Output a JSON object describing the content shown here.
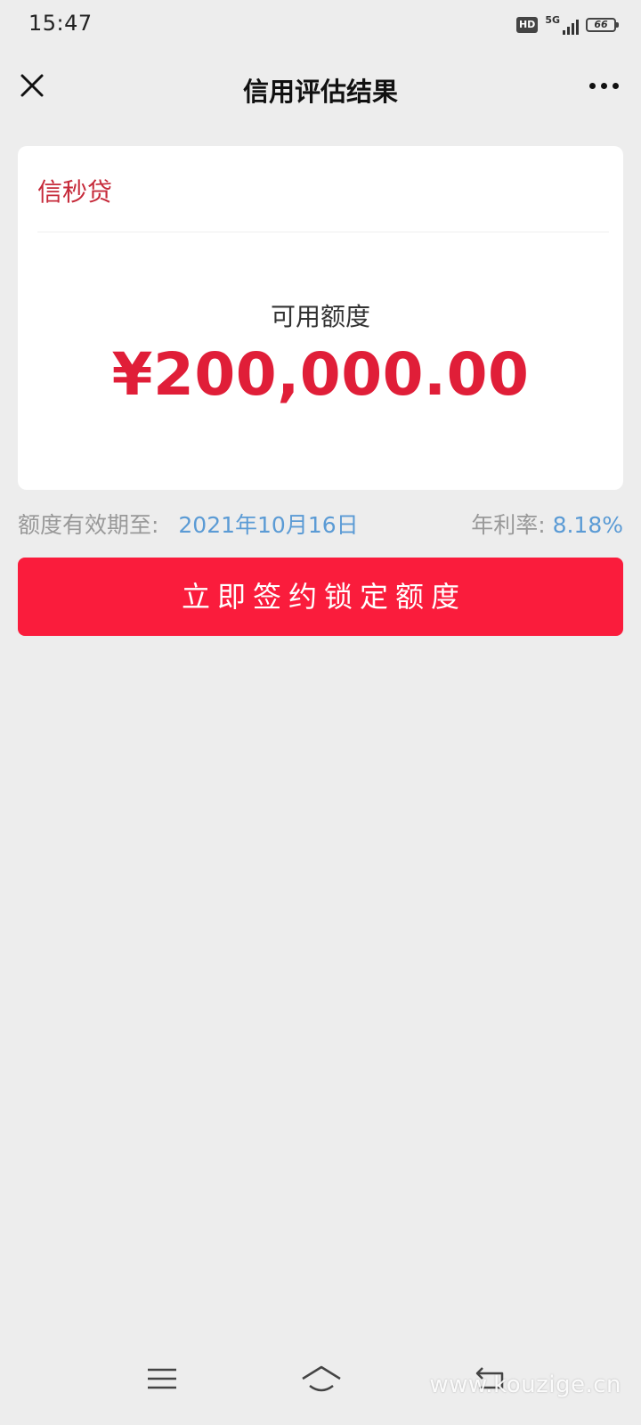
{
  "status_bar": {
    "time": "15:47",
    "hd_label": "HD",
    "network": "5G",
    "battery": "66"
  },
  "nav": {
    "title": "信用评估结果"
  },
  "card": {
    "product_name": "信秒贷",
    "limit_label": "可用额度",
    "limit_amount": "¥200,000.00"
  },
  "info": {
    "validity_label": "额度有效期至:",
    "validity_value": "2021年10月16日",
    "rate_label": "年利率:",
    "rate_value": "8.18%"
  },
  "actions": {
    "sign_label": "立即签约锁定额度"
  },
  "watermark": "www.kouzige.cn",
  "colors": {
    "accent_red": "#fa1c3c",
    "amount_red": "#e01e38",
    "product_red": "#c62a3a",
    "info_blue": "#5b9bd5",
    "background": "#ededed"
  }
}
